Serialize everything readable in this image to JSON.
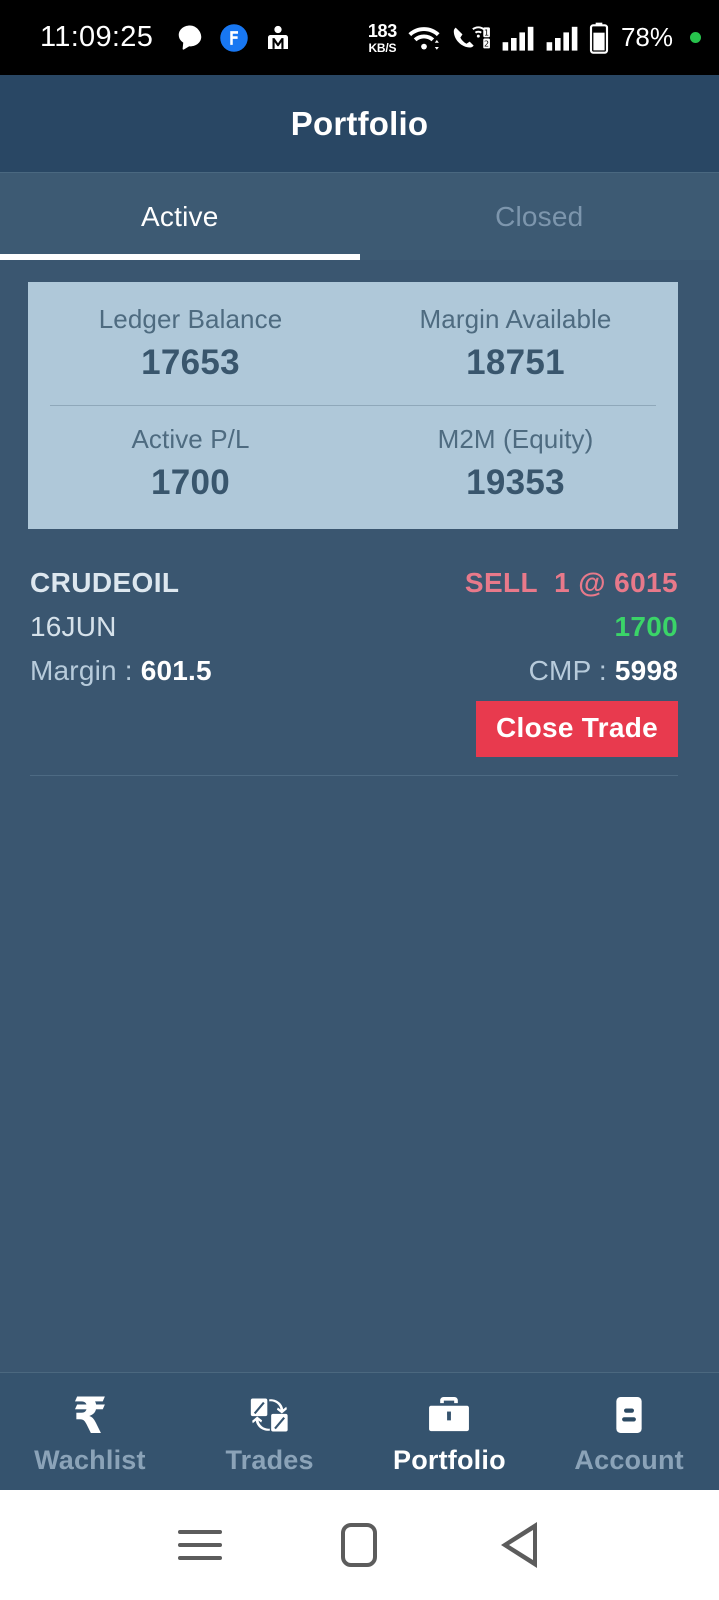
{
  "status_bar": {
    "clock": "11:09:25",
    "left_icons": [
      "chat-bubble-icon",
      "facebook-badge-icon",
      "m-person-icon"
    ],
    "network_speed_value": "183",
    "network_speed_unit": "KB/S",
    "right_icons": [
      "wifi-icon",
      "vowifi-call-icon",
      "sim1-signal-icon",
      "sim2-signal-icon",
      "battery-icon"
    ],
    "battery_percent": "78%",
    "indicator_dot_color": "#27c24c"
  },
  "header": {
    "title": "Portfolio"
  },
  "tabs": {
    "items": [
      {
        "label": "Active",
        "active": true
      },
      {
        "label": "Closed",
        "active": false
      }
    ]
  },
  "summary": {
    "cells": [
      {
        "label": "Ledger Balance",
        "value": "17653"
      },
      {
        "label": "Margin Available",
        "value": "18751"
      },
      {
        "label": "Active P/L",
        "value": "1700"
      },
      {
        "label": "M2M (Equity)",
        "value": "19353"
      }
    ]
  },
  "positions": [
    {
      "symbol": "CRUDEOIL",
      "side": "SELL",
      "qty_price": "1 @ 6015",
      "expiry": "16JUN",
      "pl": "1700",
      "margin_label": "Margin :",
      "margin_value": "601.5",
      "cmp_label": "CMP :",
      "cmp_value": "5998",
      "action_label": "Close Trade"
    }
  ],
  "bottom_nav": {
    "items": [
      {
        "label": "Wachlist",
        "icon": "rupee-icon",
        "active": false
      },
      {
        "label": "Trades",
        "icon": "exchange-icon",
        "active": false
      },
      {
        "label": "Portfolio",
        "icon": "briefcase-icon",
        "active": true
      },
      {
        "label": "Account",
        "icon": "id-card-icon",
        "active": false
      }
    ]
  },
  "android_nav": {
    "buttons": [
      "recents-button",
      "home-button",
      "back-button"
    ]
  },
  "colors": {
    "header_bg": "#294764",
    "body_bg": "#3a5670",
    "tabbar_bg": "#3d5a73",
    "card_bg": "#afc8d9",
    "sell_red": "#e8798a",
    "profit_green": "#3ad468",
    "close_btn_red": "#e83a4e",
    "bottomnav_bg": "#35536e"
  }
}
